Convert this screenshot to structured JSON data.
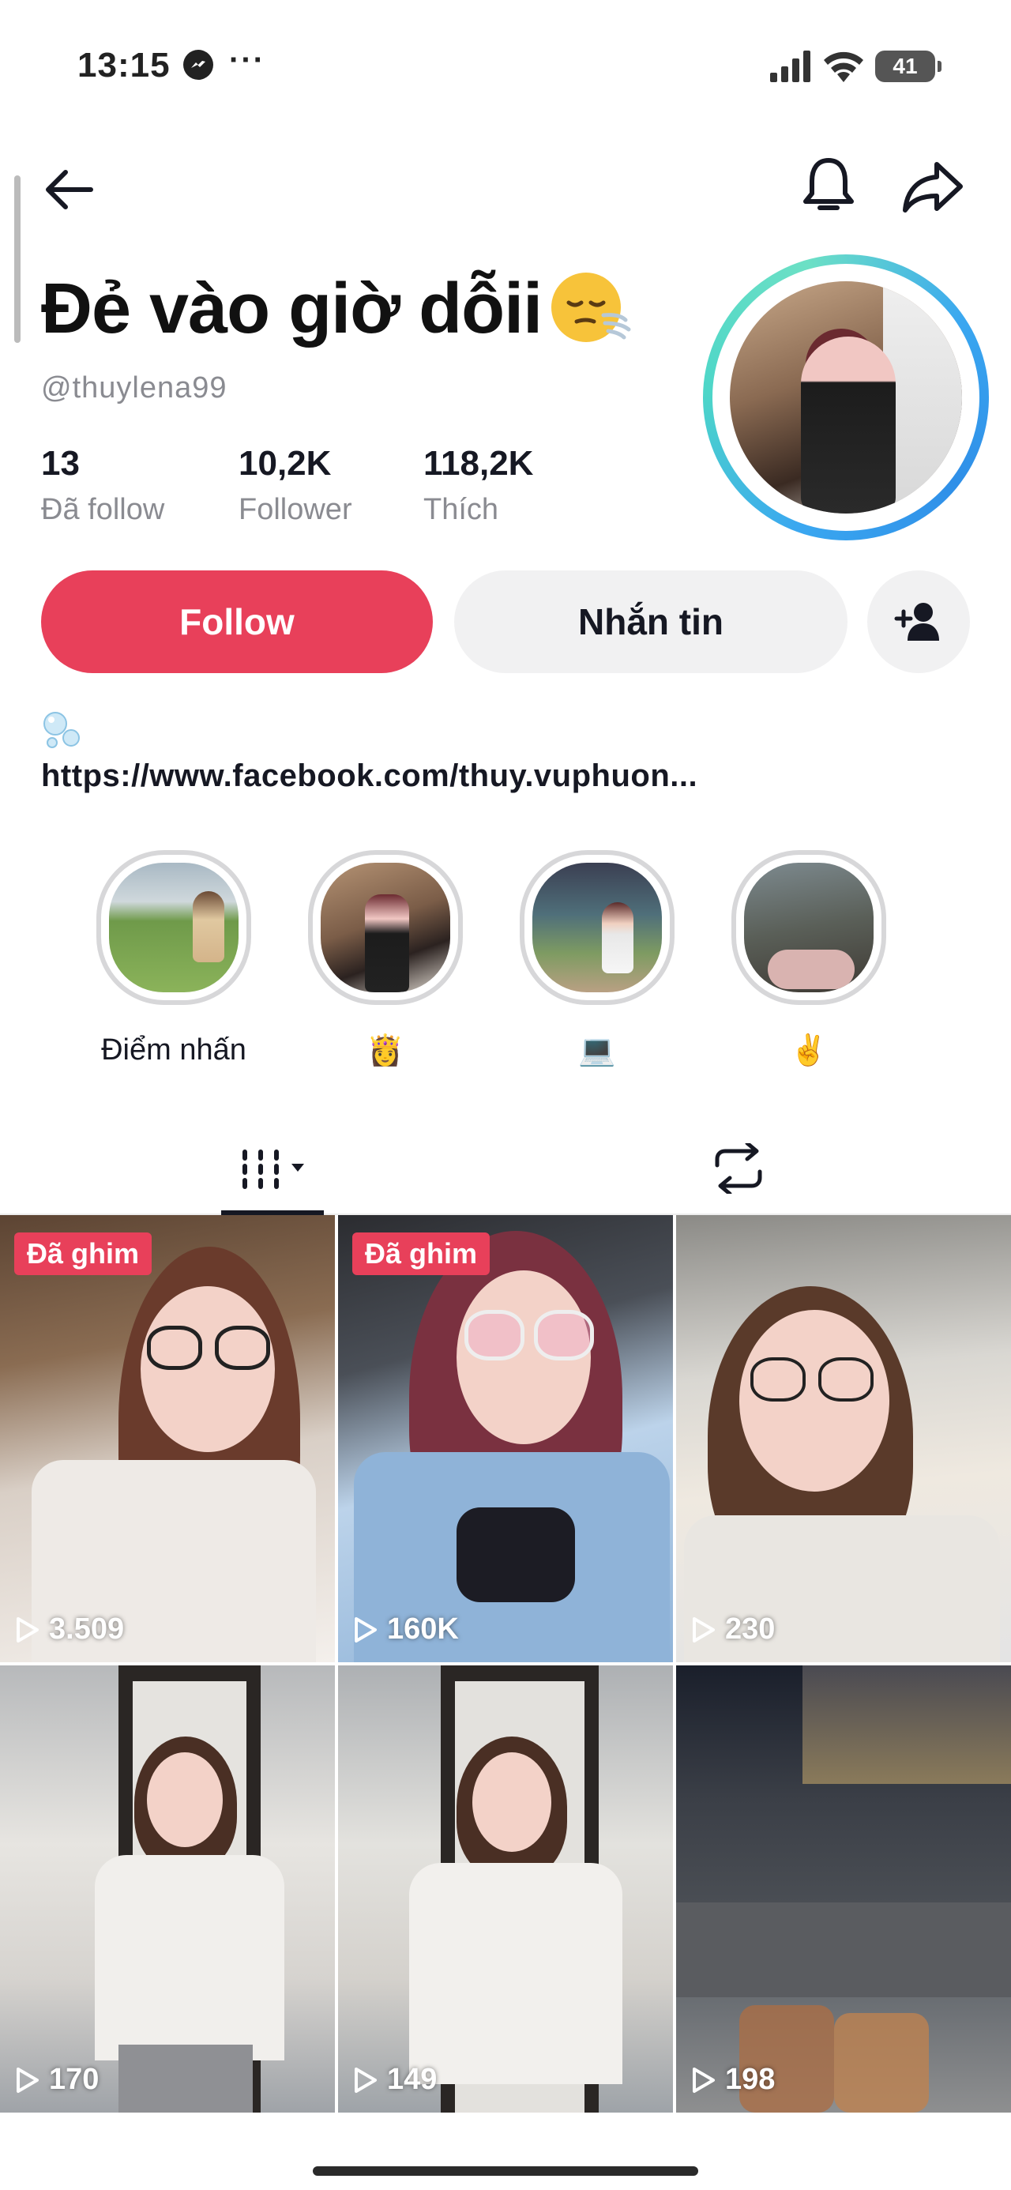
{
  "status_bar": {
    "time": "13:15",
    "battery": "41"
  },
  "profile": {
    "display_name": "Đẻ vào giờ dỗii",
    "username": "@thuylena99",
    "stats": [
      {
        "value": "13",
        "label": "Đã follow"
      },
      {
        "value": "10,2K",
        "label": "Follower"
      },
      {
        "value": "118,2K",
        "label": "Thích"
      }
    ],
    "bio_link": "https://www.facebook.com/thuy.vuphuon..."
  },
  "actions": {
    "follow_label": "Follow",
    "message_label": "Nhắn tin"
  },
  "highlights": [
    {
      "label": "Điểm nhấn"
    },
    {
      "label": "👸"
    },
    {
      "label": "💻"
    },
    {
      "label": "✌️"
    }
  ],
  "videos": [
    {
      "pinned_label": "Đã ghim",
      "views": "3.509"
    },
    {
      "pinned_label": "Đã ghim",
      "views": "160K"
    },
    {
      "pinned_label": "",
      "views": "230"
    },
    {
      "pinned_label": "",
      "views": "170"
    },
    {
      "pinned_label": "",
      "views": "149"
    },
    {
      "pinned_label": "",
      "views": "198"
    }
  ],
  "icons": {
    "back": "arrow-left-icon",
    "bell": "bell-icon",
    "share": "share-arrow-icon",
    "add_friend": "person-plus-icon",
    "videos_tab": "grid-bars-icon",
    "reposts_tab": "repost-icon",
    "play": "play-outline-icon"
  },
  "colors": {
    "follow_button": "#e8405a",
    "pin_badge": "#e8405a",
    "avatar_ring": "#3aa7f0"
  }
}
